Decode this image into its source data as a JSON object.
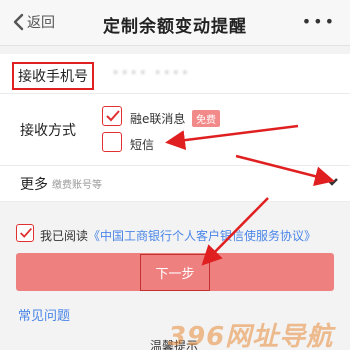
{
  "navbar": {
    "back_label": "返回",
    "title": "定制余额变动提醒",
    "more_label": "•••"
  },
  "phone_row": {
    "label": "接收手机号",
    "value": "•••• ••••"
  },
  "method_row": {
    "label": "接收方式",
    "options": [
      {
        "label": "融e联消息",
        "badge": "免费",
        "checked": true
      },
      {
        "label": "短信",
        "checked": false
      }
    ]
  },
  "more_row": {
    "label": "更多",
    "hint": "缴费账号等"
  },
  "agreement": {
    "prefix": "我已阅读",
    "link": "《中国工商银行个人客户银信使服务协议》",
    "checked": true
  },
  "next_button": {
    "label": "下一步"
  },
  "faq_label": "常见问题",
  "tips_label": "温馨提示",
  "watermark": {
    "text": "396网址导航"
  },
  "colors": {
    "accent_red": "#e02020",
    "button_fill": "#ee8080",
    "link_blue": "#4a86e8",
    "badge_fill": "#f28a8a",
    "watermark": "#e88c3a"
  }
}
